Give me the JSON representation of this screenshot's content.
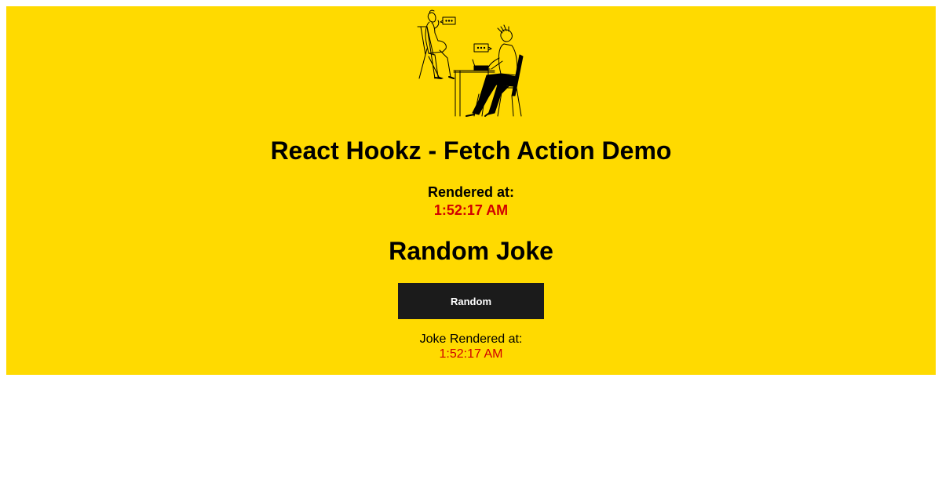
{
  "header": {
    "title": "React Hookz - Fetch Action Demo",
    "illustration_icon": "two-people-chatting-illustration"
  },
  "render_info": {
    "label": "Rendered at:",
    "time": "1:52:17 AM"
  },
  "joke": {
    "heading": "Random Joke",
    "button_label": "Random",
    "rendered_label": "Joke Rendered at:",
    "rendered_time": "1:52:17 AM"
  },
  "colors": {
    "panel_background": "#ffda00",
    "button_background": "#1b1b1b",
    "time_text": "#d10000"
  }
}
